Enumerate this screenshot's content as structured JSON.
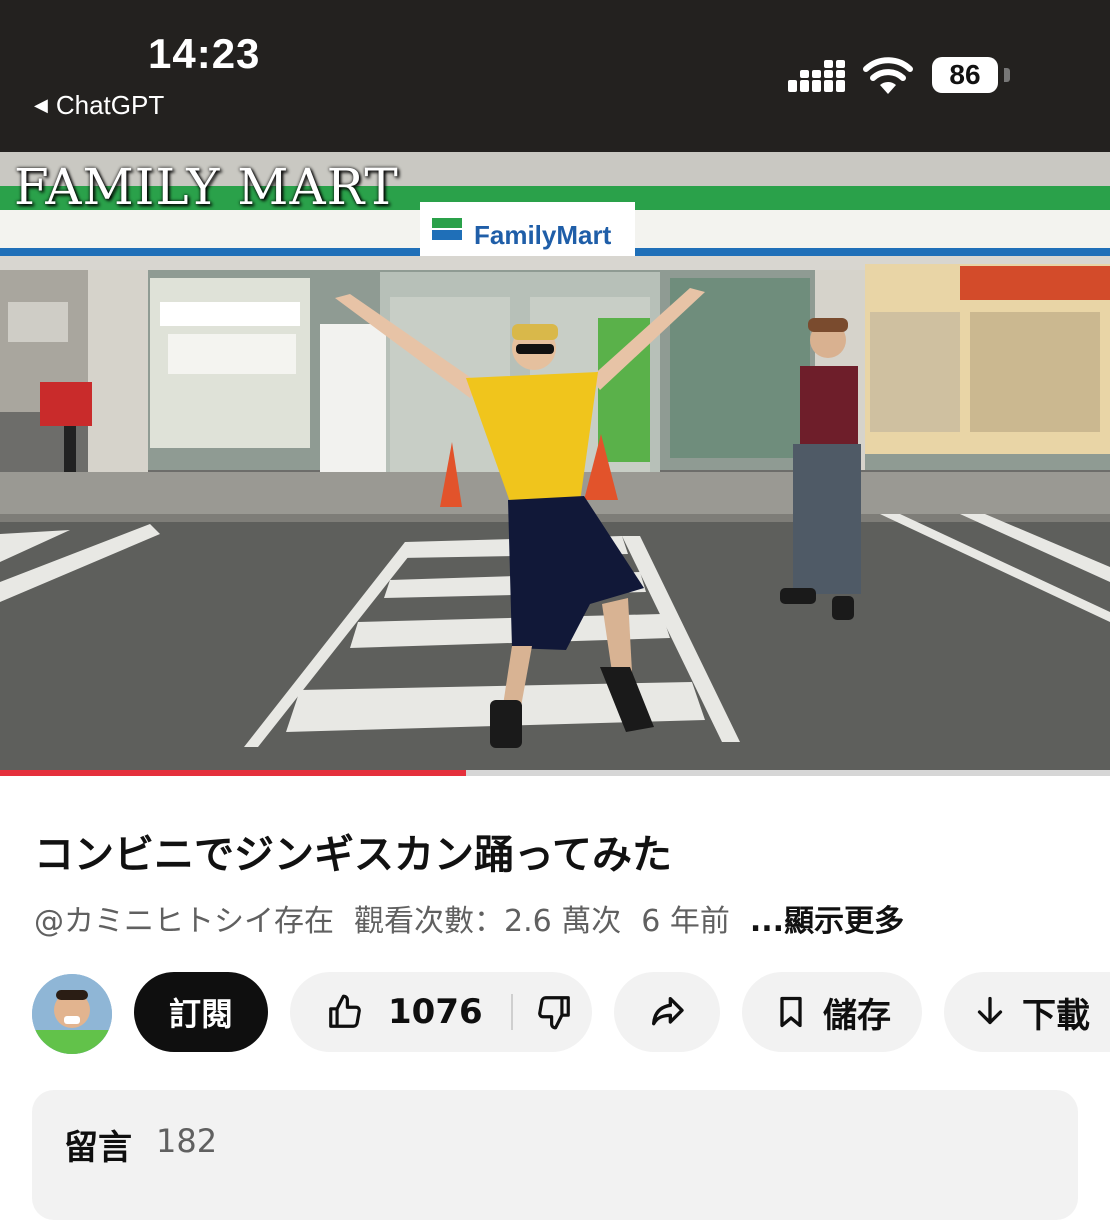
{
  "status_bar": {
    "time": "14:23",
    "back_label": "ChatGPT",
    "battery": "86",
    "icons": [
      "signal-icon",
      "wifi-icon",
      "battery-icon"
    ]
  },
  "video": {
    "overlay_title": "FAMILY MART",
    "store_sign": "FamilyMart",
    "progress": 0.42,
    "colors": {
      "progress_played": "#e5303c",
      "progress_buffered": "#d6d6d6"
    }
  },
  "details": {
    "title": "コンビニでジンギスカン踊ってみた",
    "channel": "@カミニヒトシイ存在",
    "views": "觀看次數：2.6 萬次",
    "age": "6 年前",
    "more": "...顯示更多"
  },
  "actions": {
    "subscribe": "訂閱",
    "likes": "1076",
    "save": "儲存",
    "download": "下載",
    "icons": [
      "like-icon",
      "dislike-icon",
      "share-icon",
      "bookmark-icon",
      "download-icon"
    ]
  },
  "comments": {
    "label": "留言",
    "count": "182"
  }
}
